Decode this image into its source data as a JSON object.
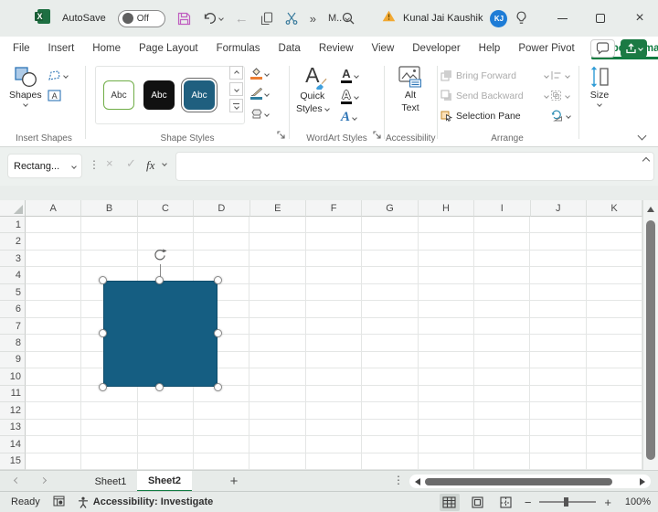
{
  "colors": {
    "excel_green": "#107C41",
    "shape_fill": "#155E82",
    "shape_border": "#0E4C6B",
    "avatar_blue": "#1E7CD6",
    "save_icon_pink": "#C05EC0",
    "warning_orange": "#F2A933"
  },
  "titlebar": {
    "autosave_label": "AutoSave",
    "autosave_state": "Off",
    "overflow_glyph": "»",
    "menu_item": "M..",
    "user_name": "Kunal Jai Kaushik",
    "user_initials": "KJ",
    "close_glyph": "×"
  },
  "ribbon": {
    "tabs": [
      "File",
      "Insert",
      "Home",
      "Page Layout",
      "Formulas",
      "Data",
      "Review",
      "View",
      "Developer",
      "Help",
      "Power Pivot",
      "Shape Format"
    ],
    "active_tab": "Shape Format",
    "groups": {
      "insert_shapes": {
        "label": "Insert Shapes",
        "shapes_button": "Shapes"
      },
      "shape_styles": {
        "label": "Shape Styles",
        "style_previews": [
          "Abc",
          "Abc",
          "Abc"
        ],
        "selected_index": 2
      },
      "wordart": {
        "label": "WordArt Styles",
        "quick_styles_line1": "Quick",
        "quick_styles_line2": "Styles"
      },
      "accessibility": {
        "label": "Accessibility",
        "alt_text_line1": "Alt",
        "alt_text_line2": "Text"
      },
      "arrange": {
        "label": "Arrange",
        "bring_forward": "Bring Forward",
        "send_backward": "Send Backward",
        "selection_pane": "Selection Pane"
      },
      "size": {
        "label": "Size"
      }
    }
  },
  "formula_bar": {
    "name_box": "Rectang...",
    "handle_glyph": "⋮",
    "cancel_glyph": "×",
    "enter_glyph": "✓",
    "fx_label": "fx",
    "formula_value": ""
  },
  "grid": {
    "columns": [
      "A",
      "B",
      "C",
      "D",
      "E",
      "F",
      "G",
      "H",
      "I",
      "J",
      "K"
    ],
    "rows": [
      "1",
      "2",
      "3",
      "4",
      "5",
      "6",
      "7",
      "8",
      "9",
      "10",
      "11",
      "12",
      "13",
      "14",
      "15"
    ]
  },
  "sheet_bar": {
    "tabs": [
      "Sheet1",
      "Sheet2"
    ],
    "active_tab": "Sheet2",
    "add_glyph": "+",
    "menu_glyph": "⋮"
  },
  "status_bar": {
    "ready": "Ready",
    "accessibility": "Accessibility: Investigate",
    "zoom_out_glyph": "−",
    "zoom_in_glyph": "+",
    "zoom_level": "100%"
  }
}
